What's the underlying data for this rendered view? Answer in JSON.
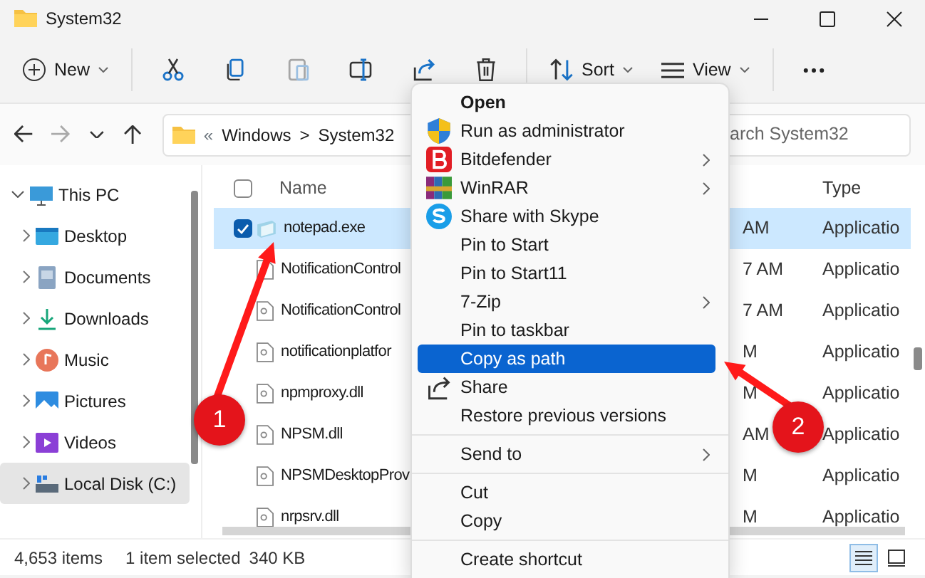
{
  "window": {
    "title": "System32"
  },
  "toolbar": {
    "items": [
      {
        "kind": "new",
        "label": "New",
        "disabled": false
      },
      {
        "kind": "cut",
        "disabled": false
      },
      {
        "kind": "copy",
        "disabled": false
      },
      {
        "kind": "paste",
        "disabled": true
      },
      {
        "kind": "rename",
        "disabled": false
      },
      {
        "kind": "share",
        "disabled": false
      },
      {
        "kind": "delete",
        "disabled": false
      },
      {
        "kind": "sort",
        "label": "Sort",
        "disabled": false
      },
      {
        "kind": "view",
        "label": "View",
        "disabled": false
      },
      {
        "kind": "more",
        "disabled": false
      }
    ]
  },
  "address_bar": {
    "overflow": "«",
    "separator": ">",
    "path": [
      "Windows",
      "System32"
    ]
  },
  "search": {
    "placeholder": "arch System32"
  },
  "sidebar": {
    "items": [
      {
        "label": "This PC",
        "kind": "pc",
        "expanded": true,
        "selected": false,
        "children": [
          {
            "label": "Desktop",
            "kind": "desktop",
            "expanded": false,
            "selected": false
          },
          {
            "label": "Documents",
            "kind": "documents",
            "expanded": false,
            "selected": false
          },
          {
            "label": "Downloads",
            "kind": "downloads",
            "expanded": false,
            "selected": false
          },
          {
            "label": "Music",
            "kind": "music",
            "expanded": false,
            "selected": false
          },
          {
            "label": "Pictures",
            "kind": "pictures",
            "expanded": false,
            "selected": false
          },
          {
            "label": "Videos",
            "kind": "videos",
            "expanded": false,
            "selected": false
          },
          {
            "label": "Local Disk (C:)",
            "kind": "disk",
            "expanded": false,
            "selected": true
          }
        ]
      }
    ]
  },
  "file_list": {
    "select_all_checked": false,
    "columns": [
      "Name",
      "Type"
    ],
    "rows": [
      {
        "kind": "exe",
        "name": "notepad.exe",
        "column_2": "AM",
        "type": "Applicatio",
        "selected": true,
        "checked": true
      },
      {
        "kind": "dll",
        "name": "NotificationControl",
        "column_2": "7 AM",
        "type": "Applicatio",
        "selected": false,
        "checked": false
      },
      {
        "kind": "dll",
        "name": "NotificationControl",
        "column_2": "7 AM",
        "type": "Applicatio",
        "selected": false,
        "checked": false
      },
      {
        "kind": "dll",
        "name": "notificationplatfor",
        "column_2": "M",
        "type": "Applicatio",
        "selected": false,
        "checked": false
      },
      {
        "kind": "dll",
        "name": "npmproxy.dll",
        "column_2": "M",
        "type": "Applicatio",
        "selected": false,
        "checked": false
      },
      {
        "kind": "dll",
        "name": "NPSM.dll",
        "column_2": "AM",
        "type": "Applicatio",
        "selected": false,
        "checked": false
      },
      {
        "kind": "dll",
        "name": "NPSMDesktopProv",
        "column_2": "M",
        "type": "Applicatio",
        "selected": false,
        "checked": false
      },
      {
        "kind": "dll",
        "name": "nrpsrv.dll",
        "column_2": "M",
        "type": "Applicatio",
        "selected": false,
        "checked": false
      }
    ]
  },
  "context_menu": {
    "items": [
      {
        "kind": "plain",
        "label": "Open",
        "default": true,
        "submenu": false,
        "selected": false
      },
      {
        "kind": "shield",
        "label": "Run as administrator",
        "default": false,
        "submenu": false,
        "selected": false
      },
      {
        "kind": "bitdefender",
        "label": "Bitdefender",
        "default": false,
        "submenu": true,
        "selected": false
      },
      {
        "kind": "winrar",
        "label": "WinRAR",
        "default": false,
        "submenu": true,
        "selected": false
      },
      {
        "kind": "skype",
        "label": "Share with Skype",
        "default": false,
        "submenu": false,
        "selected": false
      },
      {
        "kind": "plain",
        "label": "Pin to Start",
        "default": false,
        "submenu": false,
        "selected": false
      },
      {
        "kind": "plain",
        "label": "Pin to Start11",
        "default": false,
        "submenu": false,
        "selected": false
      },
      {
        "kind": "plain",
        "label": "7-Zip",
        "default": false,
        "submenu": true,
        "selected": false
      },
      {
        "kind": "plain",
        "label": "Pin to taskbar",
        "default": false,
        "submenu": false,
        "selected": false
      },
      {
        "kind": "plain",
        "label": "Copy as path",
        "default": false,
        "submenu": false,
        "selected": true
      },
      {
        "kind": "share",
        "label": "Share",
        "default": false,
        "submenu": false,
        "selected": false
      },
      {
        "kind": "plain",
        "label": "Restore previous versions",
        "default": false,
        "submenu": false,
        "selected": false
      },
      {
        "kind": "separator"
      },
      {
        "kind": "plain",
        "label": "Send to",
        "default": false,
        "submenu": true,
        "selected": false
      },
      {
        "kind": "separator"
      },
      {
        "kind": "plain",
        "label": "Cut",
        "default": false,
        "submenu": false,
        "selected": false
      },
      {
        "kind": "plain",
        "label": "Copy",
        "default": false,
        "submenu": false,
        "selected": false
      },
      {
        "kind": "separator"
      },
      {
        "kind": "plain",
        "label": "Create shortcut",
        "default": false,
        "submenu": false,
        "selected": false
      }
    ]
  },
  "status_bar": {
    "item_count": "4,653 items",
    "selection": "1 item selected",
    "size": "340 KB",
    "views": [
      {
        "kind": "details",
        "selected": true
      },
      {
        "kind": "tiles",
        "selected": false
      }
    ]
  },
  "callouts": [
    {
      "number": "1"
    },
    {
      "number": "2"
    }
  ]
}
